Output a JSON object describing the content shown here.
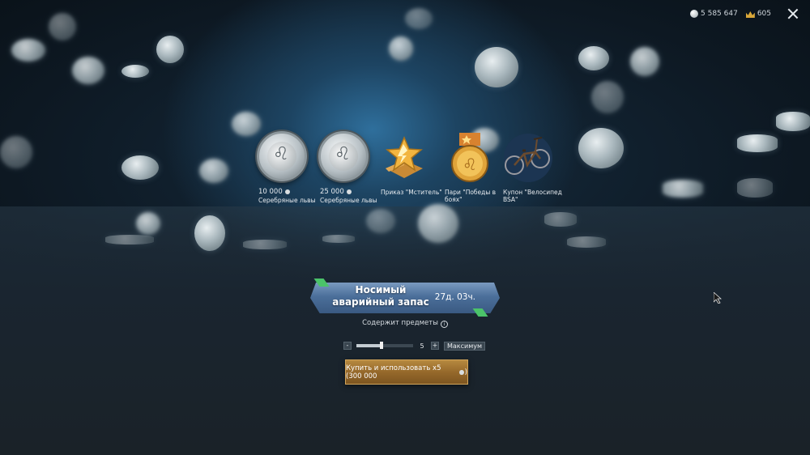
{
  "currency": {
    "silver": "5 585 647",
    "gold": "605"
  },
  "rewards": [
    {
      "amount": "10 000",
      "label": "Серебряные львы",
      "icon": "silver-lion-coin-icon"
    },
    {
      "amount": "25 000",
      "label": "Серебряные львы",
      "icon": "silver-lion-coin-icon"
    },
    {
      "amount": "",
      "label": "Приказ \"Мститель\"",
      "icon": "order-star-icon"
    },
    {
      "amount": "",
      "label": "Пари \"Победы в боях\"",
      "icon": "gold-medal-icon"
    },
    {
      "amount": "",
      "label": "Купон \"Велосипед BSA\"",
      "icon": "bicycle-icon"
    }
  ],
  "offer": {
    "title": "Носимый аварийный запас",
    "timer": "27д. 03ч.",
    "contains_label": "Содержит предметы"
  },
  "quantity": {
    "minus": "-",
    "plus": "+",
    "value": "5",
    "fill_fraction": 0.44,
    "max_label": "Максимум"
  },
  "buy_button": {
    "label": "Купить и использовать x5 (300 000",
    "suffix": ")"
  },
  "colors": {
    "banner": "#4b6f9a",
    "ribbon": "#4bc36a",
    "buy": "#96692b",
    "gold": "#d9a739"
  }
}
